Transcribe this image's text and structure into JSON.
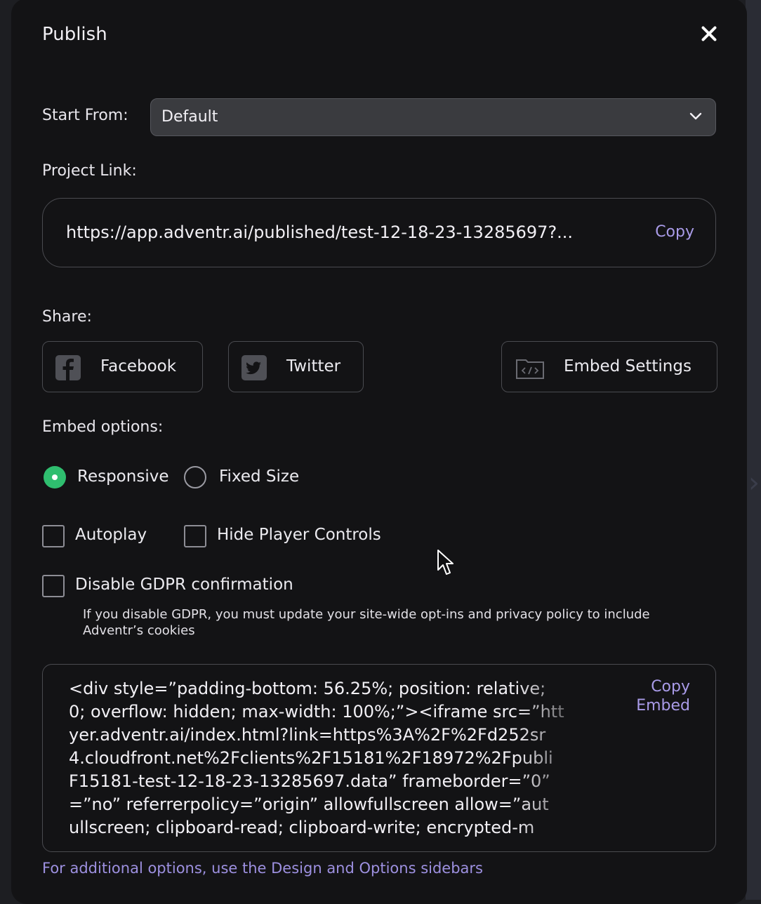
{
  "dialog": {
    "title": "Publish",
    "close_icon": "close-icon"
  },
  "start_from": {
    "label": "Start From:",
    "value": "Default"
  },
  "project_link": {
    "label": "Project Link:",
    "url": "https://app.adventr.ai/published/test-12-18-23-13285697?...",
    "copy_label": "Copy"
  },
  "share": {
    "label": "Share:",
    "facebook": {
      "label": "Facebook",
      "icon": "facebook-icon"
    },
    "twitter": {
      "label": "Twitter",
      "icon": "twitter-icon"
    },
    "embed_settings": {
      "label": "Embed Settings",
      "icon": "code-folder-icon"
    }
  },
  "embed_options": {
    "label": "Embed options:",
    "responsive": {
      "label": "Responsive",
      "selected": true
    },
    "fixed_size": {
      "label": "Fixed Size",
      "selected": false
    },
    "autoplay": {
      "label": "Autoplay",
      "checked": false
    },
    "hide_controls": {
      "label": "Hide Player Controls",
      "checked": false
    },
    "disable_gdpr": {
      "label": "Disable GDPR confirmation",
      "checked": false
    },
    "gdpr_note": "If you disable GDPR, you must update your site-wide opt-ins and privacy policy to include Adventr’s cookies"
  },
  "embed_code": {
    "lines": [
      "<div style=”padding-bottom: 56.25%; position: relative;",
      "0; overflow: hidden; max-width: 100%;”><iframe src=”htt",
      "yer.adventr.ai/index.html?link=https%3A%2F%2Fd252sr",
      "4.cloudfront.net%2Fclients%2F15181%2F18972%2Fpubli",
      "F15181-test-12-18-23-13285697.data” frameborder=”0”",
      "=”no” referrerpolicy=”origin” allowfullscreen allow=”aut",
      "ullscreen; clipboard-read; clipboard-write; encrypted-m"
    ],
    "copy_label_1": "Copy",
    "copy_label_2": "Embed"
  },
  "footer": "For additional options, use the Design and Options sidebars",
  "colors": {
    "accent": "#a99be8",
    "radio_on": "#2fbe6f",
    "modal_bg": "#131315"
  }
}
